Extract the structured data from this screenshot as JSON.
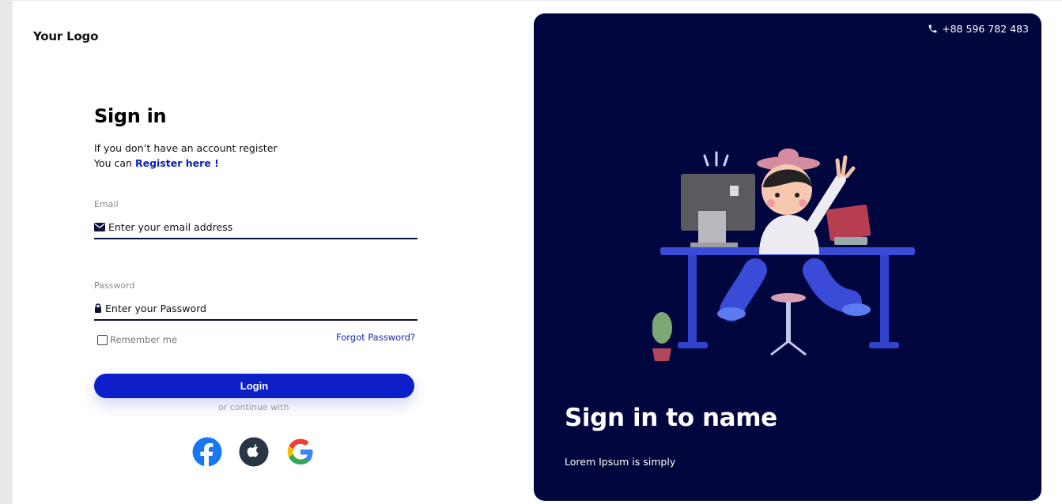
{
  "brand": {
    "logo_text": "Your Logo"
  },
  "signin": {
    "title": "Sign in",
    "subtitle_line1": "If you don’t have an account register",
    "subtitle_prefix": "You can",
    "register_link": "Register here !",
    "email_label": "Email",
    "email_placeholder": "Enter your email address",
    "password_label": "Password",
    "password_placeholder": "Enter your Password",
    "remember_label": "Remember me",
    "remember_checked": false,
    "forgot_link": "Forgot Password?",
    "login_button": "Login",
    "continue_text": "or continue with",
    "social": [
      "facebook-icon",
      "apple-icon",
      "google-icon"
    ]
  },
  "promo": {
    "phone": "+88 596 782 483",
    "title": "Sign in to name",
    "text": "Lorem Ipsum is simply"
  },
  "colors": {
    "accent": "#0c1fc8",
    "panel_bg": "#02063f",
    "link": "#0a1fb7"
  }
}
